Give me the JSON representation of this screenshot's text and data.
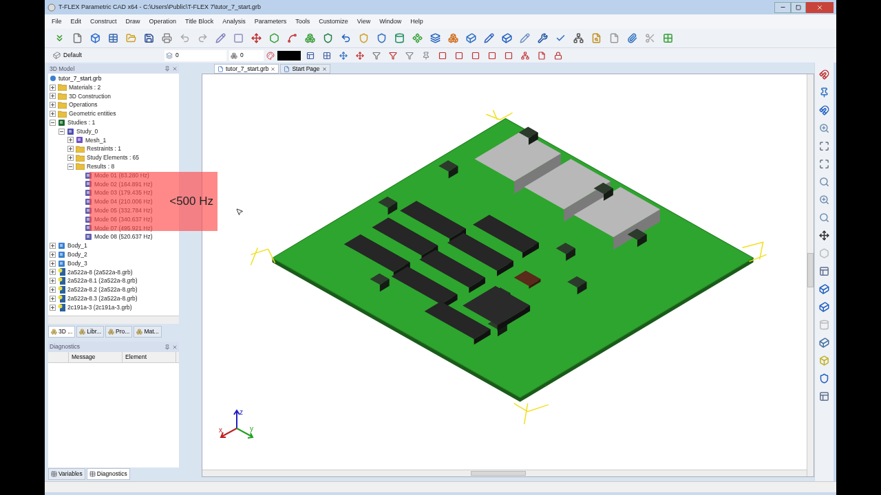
{
  "window": {
    "title": "T-FLEX Parametric CAD x64 - C:\\Users\\Public\\T-FLEX 7\\tutor_7_start.grb"
  },
  "menu": [
    "File",
    "Edit",
    "Construct",
    "Draw",
    "Operation",
    "Title Block",
    "Analysis",
    "Parameters",
    "Tools",
    "Customize",
    "View",
    "Window",
    "Help"
  ],
  "properties_bar": {
    "style": "Default",
    "layer": "0",
    "level": "0"
  },
  "model_panel": {
    "title": "3D Model",
    "root": "tutor_7_start.grb",
    "items": [
      {
        "label": "Materials : 2",
        "kind": "folder",
        "expanded": false
      },
      {
        "label": "3D Construction",
        "kind": "folder",
        "expanded": false
      },
      {
        "label": "Operations",
        "kind": "folder",
        "expanded": false
      },
      {
        "label": "Geometric entities",
        "kind": "folder",
        "expanded": false
      },
      {
        "label": "Studies : 1",
        "kind": "studies",
        "expanded": true,
        "children": [
          {
            "label": "Study_0",
            "kind": "study",
            "expanded": true,
            "children": [
              {
                "label": "Mesh_1",
                "kind": "mesh",
                "expanded": false
              },
              {
                "label": "Restraints : 1",
                "kind": "folder",
                "expanded": false
              },
              {
                "label": "Study Elements : 65",
                "kind": "folder",
                "expanded": false
              },
              {
                "label": "Results : 8",
                "kind": "folder",
                "expanded": true,
                "children": [
                  {
                    "label": "Mode 01 (83.280 Hz)",
                    "kind": "mode"
                  },
                  {
                    "label": "Mode 02 (164.891 Hz)",
                    "kind": "mode"
                  },
                  {
                    "label": "Mode 03 (179.435 Hz)",
                    "kind": "mode"
                  },
                  {
                    "label": "Mode 04 (210.006 Hz)",
                    "kind": "mode"
                  },
                  {
                    "label": "Mode 05 (332.784 Hz)",
                    "kind": "mode"
                  },
                  {
                    "label": "Mode 06 (340.637 Hz)",
                    "kind": "mode"
                  },
                  {
                    "label": "Mode 07 (495.921 Hz)",
                    "kind": "mode"
                  },
                  {
                    "label": "Mode 08 (520.637 Hz)",
                    "kind": "mode"
                  }
                ]
              }
            ]
          }
        ]
      },
      {
        "label": "Body_1",
        "kind": "body",
        "expanded": false
      },
      {
        "label": "Body_2",
        "kind": "body",
        "expanded": false
      },
      {
        "label": "Body_3",
        "kind": "body",
        "expanded": false
      },
      {
        "label": "2a522a-8 (2a522a-8.grb)",
        "kind": "part",
        "expanded": false
      },
      {
        "label": "2a522a-8.1 (2a522a-8.grb)",
        "kind": "part",
        "expanded": false
      },
      {
        "label": "2a522a-8.2 (2a522a-8.grb)",
        "kind": "part",
        "expanded": false
      },
      {
        "label": "2a522a-8.3 (2a522a-8.grb)",
        "kind": "part",
        "expanded": false
      },
      {
        "label": "2c191a-3 (2c191a-3.grb)",
        "kind": "part",
        "expanded": false
      }
    ],
    "tabs": [
      {
        "label": "3D ...",
        "selected": true
      },
      {
        "label": "Libr...",
        "selected": false
      },
      {
        "label": "Pro...",
        "selected": false
      },
      {
        "label": "Mat...",
        "selected": false
      }
    ]
  },
  "diagnostics_panel": {
    "title": "Diagnostics",
    "columns": [
      "Message",
      "Element"
    ],
    "tabs": [
      {
        "label": "Variables",
        "selected": false
      },
      {
        "label": "Diagnostics",
        "selected": true
      }
    ]
  },
  "document_tabs": [
    {
      "label": "tutor_7_start.grb",
      "selected": true
    },
    {
      "label": "Start Page",
      "selected": false
    }
  ],
  "annotation": {
    "text": "<500 Hz"
  },
  "axes": [
    "x",
    "y",
    "z"
  ]
}
